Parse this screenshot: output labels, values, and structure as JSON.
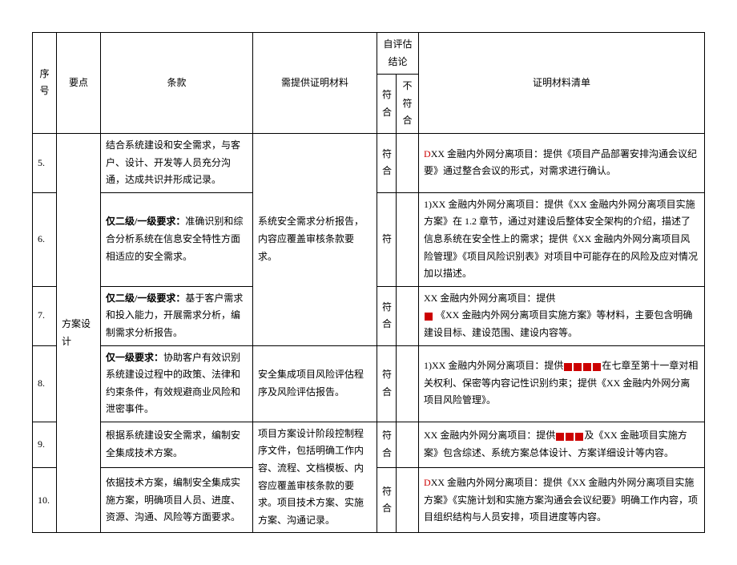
{
  "headers": {
    "num": "序号",
    "point": "要点",
    "clause": "条款",
    "evidence": "需提供证明材料",
    "assess_group": "自评估结论",
    "conform": "符合",
    "nonconform": "不符合",
    "list": "证明材料清单"
  },
  "point_label": "方案设计",
  "rows": {
    "5": {
      "num": "5.",
      "clause": "结合系统建设和安全需求，与客户、设计、开发等人员充分沟通，达成共识并形成记录。",
      "conform": "符合",
      "list_prefix": "D",
      "list": "XX 金融内外网分离项目：提供《项目产品部署安排沟通会议纪要》通过整合会议的形式，对需求进行确认。"
    },
    "6": {
      "num": "6.",
      "clause_prefix": "仅二级/一级要求：",
      "clause": "准确识别和综合分析系统在信息安全特性方面相适应的安全需求。",
      "conform": "符",
      "list": "1)XX 金融内外网分离项目：提供《XX 金融内外网分离项目实施方案》在 1.2 章节，通过对建设后整体安全架构的介绍，描述了信息系统在安全性上的需求；提供《XX 金融内外网分离项目风险管理》《项目风险识别表》对项目中可能存在的风险及应对情况加以描述。"
    },
    "evidence_6_7": "系统安全需求分析报告，内容应覆盖审核条款要求。",
    "7": {
      "num": "7.",
      "clause_prefix": "仅二级/一级要求：",
      "clause": "基于客户需求和投入能力，开展需求分析，编制需求分析报告。",
      "conform": "符合",
      "list_a": "XX 金融内外网分离项目：提供",
      "list_b": "《XX 金融内外网分离项目实施方案》等材料，主要包含明确建设目标、建设范围、建设内容等。"
    },
    "8": {
      "num": "8.",
      "clause_prefix": "仅一级要求：",
      "clause": "协助客户有效识别系统建设过程中的政策、法律和约束条件，有效规避商业风险和泄密事件。",
      "evidence": "安全集成项目风险评估程序及风险评估报告。",
      "conform": "符合",
      "list_a": "1)XX 金融内外网分离项目：提供",
      "list_b": "在七章至第十一章对相关权利、保密等内容记性识别约束；提供《XX 金融内外网分离项目风险管理》。"
    },
    "9": {
      "num": "9.",
      "clause": "根据系统建设安全需求，编制安全集成技术方案。",
      "conform": "符合",
      "list_a": "XX 金融内外网分离项目：提供",
      "list_b": "及《XX 金融项目实施方案》包含综述、系统方案总体设计、方案详细设计等内容。"
    },
    "evidence_9_10": "项目方案设计阶段控制程序文件，包括明确工作内容、流程、文档模板、内容应覆盖审核条款的要求。项目技术方案、实施方案、沟通记录。",
    "10": {
      "num": "10.",
      "clause": "依据技术方案，编制安全集成实施方案，明确项目人员、进度、资源、沟通、风险等方面要求。",
      "conform": "符合",
      "list_prefix": "D",
      "list": "XX 金融内外网分离项目：提供《XX 金融内外网分离项目实施方案》《实施计划和实施方案沟通会会议纪要》明确工作内容，项目组织结构与人员安排，项目进度等内容。"
    }
  }
}
